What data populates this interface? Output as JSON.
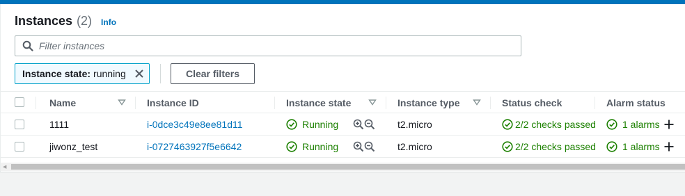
{
  "colors": {
    "accent": "#0073bb",
    "success": "#1d8102",
    "token_bg": "#f1faff",
    "token_border": "#00a1c9"
  },
  "header": {
    "title": "Instances",
    "count": "(2)",
    "info": "Info"
  },
  "search": {
    "placeholder": "Filter instances",
    "icon": "search-icon"
  },
  "filter_token": {
    "key": "Instance state:",
    "value": "running",
    "remove_icon": "close-icon"
  },
  "clear_filters_label": "Clear filters",
  "columns": [
    "Name",
    "Instance ID",
    "Instance state",
    "Instance type",
    "Status check",
    "Alarm status"
  ],
  "rows": [
    {
      "name": "1111",
      "instance_id": "i-0dce3c49e8ee81d11",
      "state": "Running",
      "type": "t2.micro",
      "status_check": "2/2 checks passed",
      "alarm": "1 alarms"
    },
    {
      "name": "jiwonz_test",
      "instance_id": "i-0727463927f5e6642",
      "state": "Running",
      "type": "t2.micro",
      "status_check": "2/2 checks passed",
      "alarm": "1 alarms"
    }
  ]
}
